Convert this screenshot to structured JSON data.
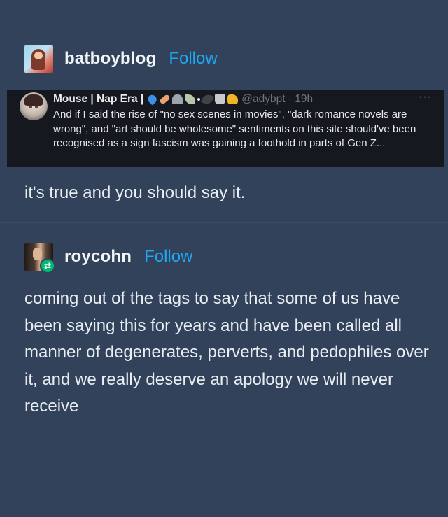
{
  "post1": {
    "username": "batboyblog",
    "follow_label": "Follow",
    "body": "it's true and you should say it.",
    "embedded_tweet": {
      "display_name": "Mouse | Nap Era |",
      "emoji_icons": [
        "blue-heart",
        "bandage",
        "headstone",
        "leaf",
        "dot",
        "feather",
        "basket",
        "thumbs-up"
      ],
      "handle_time": "@adybpt · 19h",
      "more": "···",
      "text": "And if I said the rise of \"no sex scenes in movies\", \"dark romance novels are wrong\", and \"art should be wholesome\" sentiments on this site should've been recognised as a sign fascism was gaining a foothold in parts of Gen Z..."
    }
  },
  "post2": {
    "username": "roycohn",
    "follow_label": "Follow",
    "reblog_icon": "⇄",
    "body": "coming out of the tags to say that some of us have been saying this for years and have been called all manner of degenerates, perverts, and pedophiles over it, and we really deserve an apology we will never receive"
  },
  "colors": {
    "background": "#31425a",
    "follow": "#1fa7f3",
    "tweet_background": "#15181e",
    "reblog_badge": "#02b875"
  }
}
